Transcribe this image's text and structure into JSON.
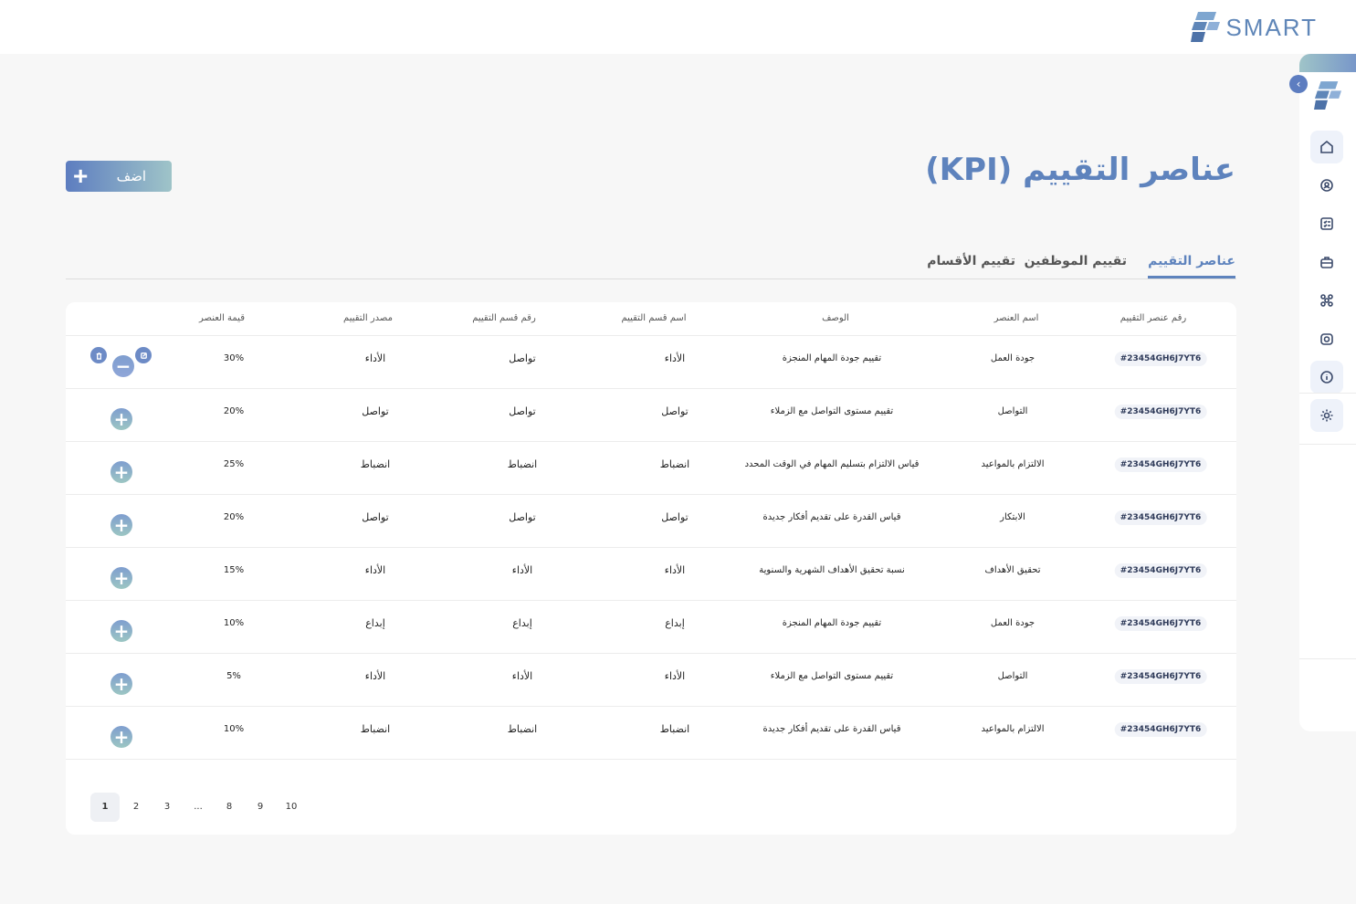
{
  "brand": {
    "name": "SMART",
    "color": "#5f86b8"
  },
  "header": {
    "title": "عناصر التقييم (KPI)",
    "add_label": "اضف"
  },
  "tabs": [
    {
      "label": "عناصر التقييم",
      "active": true
    },
    {
      "label": "تقييم الموظفين",
      "active": false
    },
    {
      "label": "تقييم الأقسام",
      "active": false
    }
  ],
  "sidebar": {
    "items": [
      {
        "icon": "home-icon",
        "active": true
      },
      {
        "icon": "user-location-icon",
        "active": false
      },
      {
        "icon": "checklist-icon",
        "active": false
      },
      {
        "icon": "briefcase-icon",
        "active": false
      },
      {
        "icon": "org-chart-icon",
        "active": false
      },
      {
        "icon": "camera-icon",
        "active": false
      },
      {
        "icon": "info-icon",
        "active": true
      },
      {
        "icon": "settings-icon",
        "active": true
      }
    ]
  },
  "table": {
    "columns": {
      "id": "رقم عنصر التقييم",
      "name": "اسم العنصر",
      "description": "الوصف",
      "section_name": "اسم قسم التقييم",
      "section_no": "رقم قسم التقييم",
      "source": "مصدر التقييم",
      "value": "قيمة العنصر"
    },
    "rows": [
      {
        "id": "#23454GH6J7YT6",
        "name": "جودة العمل",
        "description": "تقييم جودة المهام المنجزة",
        "section_name": "الأداء",
        "section_no": "تواصل",
        "source": "الأداء",
        "value": "30%",
        "expanded": true
      },
      {
        "id": "#23454GH6J7YT6",
        "name": "التواصل",
        "description": "تقييم مستوى التواصل مع الزملاء",
        "section_name": "تواصل",
        "section_no": "تواصل",
        "source": "تواصل",
        "value": "20%",
        "expanded": false
      },
      {
        "id": "#23454GH6J7YT6",
        "name": "الالتزام بالمواعيد",
        "description": "قياس الالتزام بتسليم المهام في الوقت المحدد",
        "section_name": "انضباط",
        "section_no": "انضباط",
        "source": "انضباط",
        "value": "25%",
        "expanded": false
      },
      {
        "id": "#23454GH6J7YT6",
        "name": "الابتكار",
        "description": "قياس القدرة على تقديم أفكار جديدة",
        "section_name": "تواصل",
        "section_no": "تواصل",
        "source": "تواصل",
        "value": "20%",
        "expanded": false
      },
      {
        "id": "#23454GH6J7YT6",
        "name": "تحقيق الأهداف",
        "description": "نسبة تحقيق الأهداف الشهرية والسنوية",
        "section_name": "الأداء",
        "section_no": "الأداء",
        "source": "الأداء",
        "value": "15%",
        "expanded": false
      },
      {
        "id": "#23454GH6J7YT6",
        "name": "جودة العمل",
        "description": "تقييم جودة المهام المنجزة",
        "section_name": "إبداع",
        "section_no": "إبداع",
        "source": "إبداع",
        "value": "10%",
        "expanded": false
      },
      {
        "id": "#23454GH6J7YT6",
        "name": "التواصل",
        "description": "تقييم مستوى التواصل مع الزملاء",
        "section_name": "الأداء",
        "section_no": "الأداء",
        "source": "الأداء",
        "value": "5%",
        "expanded": false
      },
      {
        "id": "#23454GH6J7YT6",
        "name": "الالتزام بالمواعيد",
        "description": "قياس القدرة على تقديم أفكار جديدة",
        "section_name": "انضباط",
        "section_no": "انضباط",
        "source": "انضباط",
        "value": "10%",
        "expanded": false
      }
    ]
  },
  "pagination": {
    "pages": [
      "1",
      "2",
      "3",
      "...",
      "8",
      "9",
      "10"
    ],
    "current": "1"
  },
  "colors": {
    "accent": "#5e83bd",
    "gradient_start": "#5d7dc0",
    "gradient_end": "#9fc4c8"
  }
}
